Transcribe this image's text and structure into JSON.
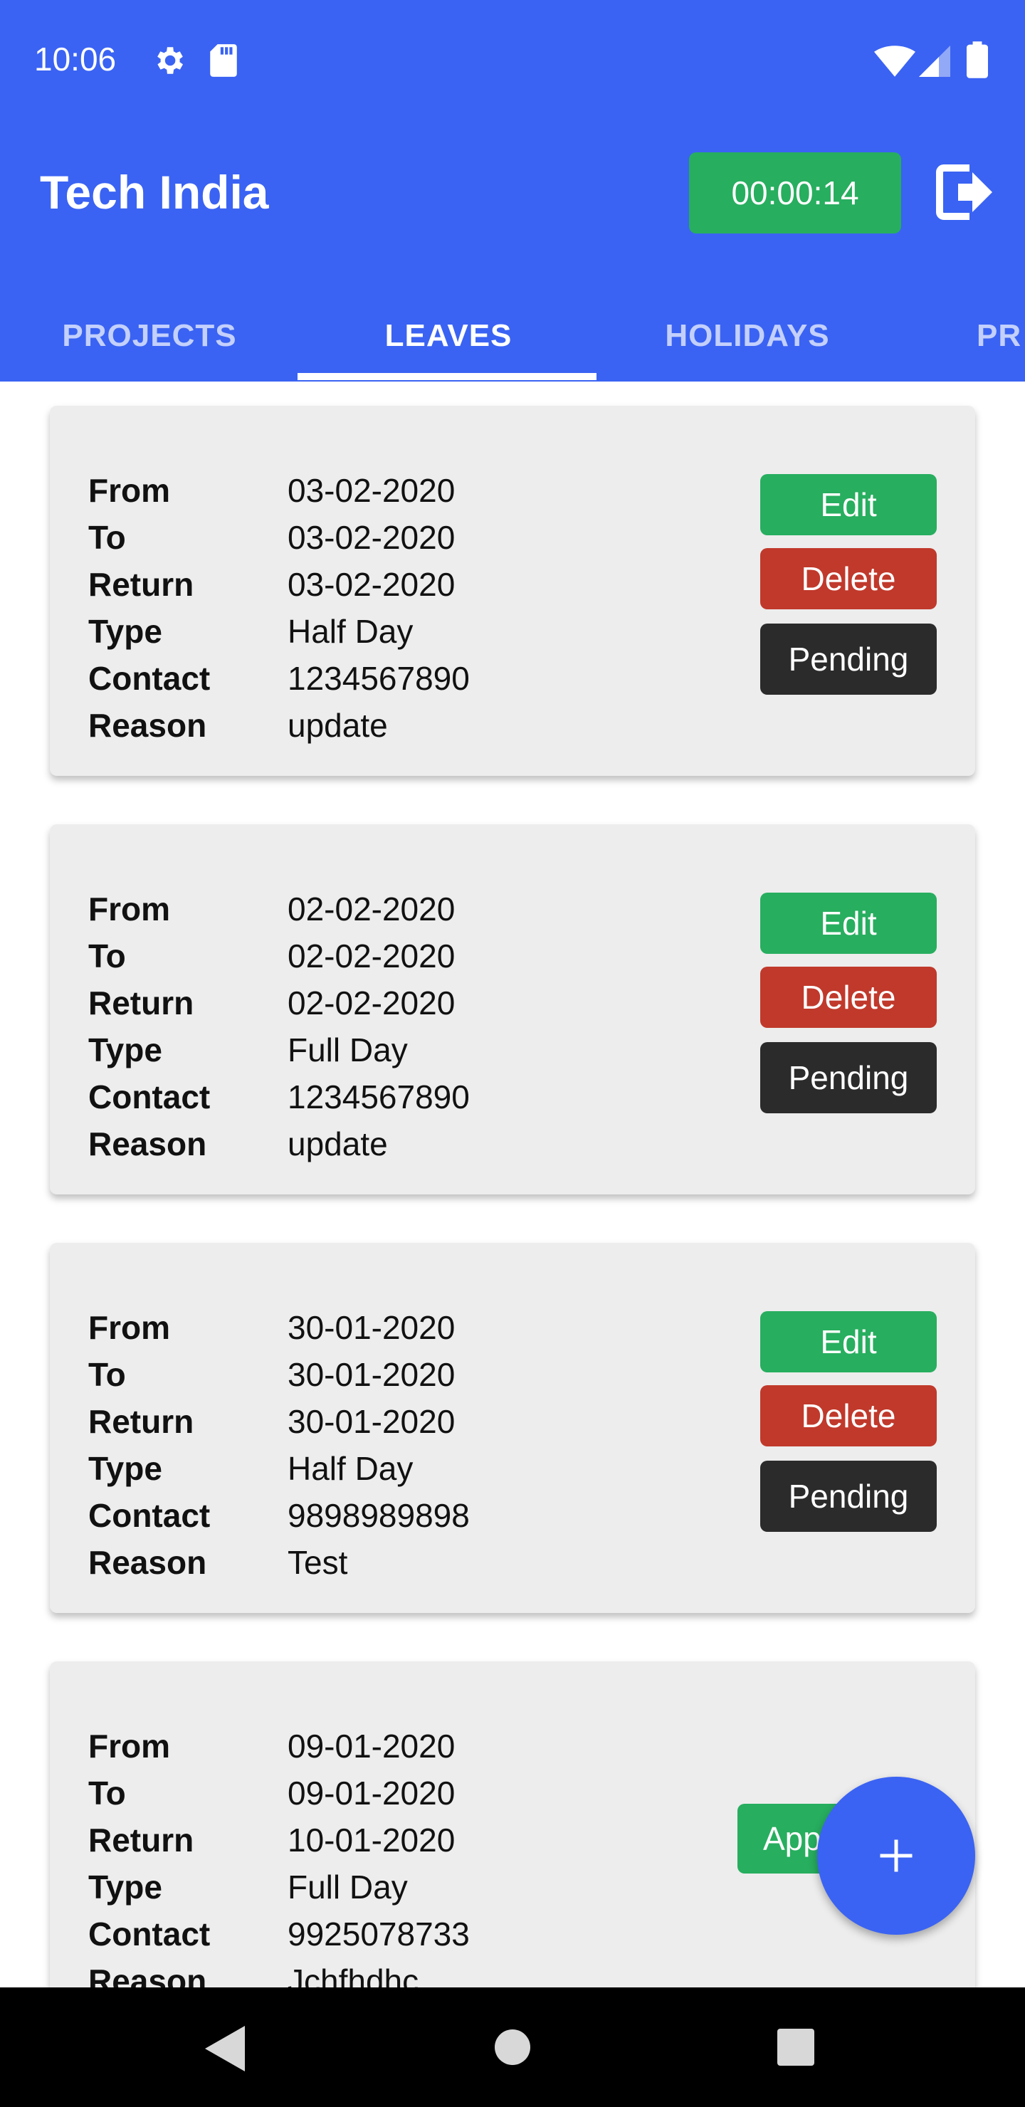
{
  "status_bar": {
    "time": "10:06",
    "icons": [
      "gear-icon",
      "sd-card-icon",
      "wifi-icon",
      "cell-signal-icon",
      "battery-icon"
    ]
  },
  "app_bar": {
    "title": "Tech India",
    "timer": "00:00:14",
    "timer_color": "#27ae5f",
    "color": "#3a63f3"
  },
  "tabs": [
    {
      "label": "PROJECTS",
      "active": false
    },
    {
      "label": "LEAVES",
      "active": true
    },
    {
      "label": "HOLIDAYS",
      "active": false
    },
    {
      "label": "PR",
      "active": false
    }
  ],
  "field_labels": {
    "from": "From",
    "to": "To",
    "return": "Return",
    "type": "Type",
    "contact": "Contact",
    "reason": "Reason"
  },
  "buttons": {
    "edit": "Edit",
    "delete": "Delete",
    "pending": "Pending",
    "approved": "App"
  },
  "leaves": [
    {
      "from": "03-02-2020",
      "to": "03-02-2020",
      "return": "03-02-2020",
      "type": "Half Day",
      "contact": "1234567890",
      "reason": "update",
      "status": "Pending"
    },
    {
      "from": "02-02-2020",
      "to": "02-02-2020",
      "return": "02-02-2020",
      "type": "Full Day",
      "contact": "1234567890",
      "reason": "update",
      "status": "Pending"
    },
    {
      "from": "30-01-2020",
      "to": "30-01-2020",
      "return": "30-01-2020",
      "type": "Half Day",
      "contact": "9898989898",
      "reason": "Test",
      "status": "Pending"
    },
    {
      "from": "09-01-2020",
      "to": "09-01-2020",
      "return": "10-01-2020",
      "type": "Full Day",
      "contact": "9925078733",
      "reason": "Jchfhdhc",
      "status": "App"
    }
  ],
  "colors": {
    "edit": "#27ae5f",
    "delete": "#c0392b",
    "pending": "#2b2b2b",
    "fab": "#3a63f3"
  },
  "fab_icon": "plus-icon",
  "nav_icons": [
    "back-icon",
    "home-icon",
    "recents-icon"
  ]
}
